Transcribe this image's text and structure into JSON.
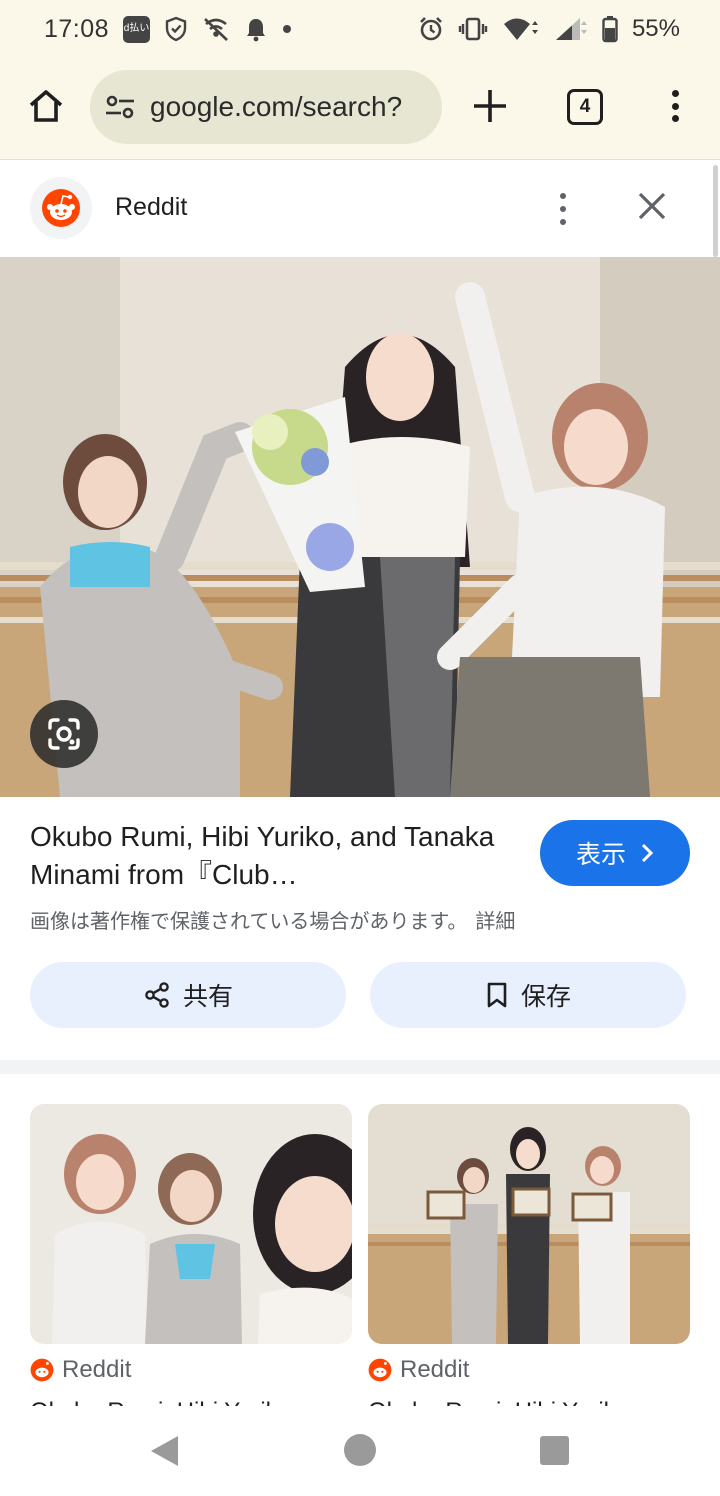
{
  "status_bar": {
    "time": "17:08",
    "dpay_badge": "d払い",
    "battery": "55%",
    "icons": [
      "dpay-icon",
      "shield-icon",
      "wifi-off-call-icon",
      "bell-icon",
      "dot-icon",
      "alarm-icon",
      "vibrate-icon",
      "wifi-icon",
      "signal-icon",
      "battery-icon"
    ]
  },
  "browser": {
    "url": "google.com/search?",
    "tab_count": "4",
    "icons": [
      "home-icon",
      "site-settings-icon",
      "plus-icon",
      "tabs-icon",
      "more-vert-icon"
    ]
  },
  "source": {
    "name": "Reddit",
    "icons": [
      "reddit-icon",
      "more-vert-icon",
      "close-icon"
    ]
  },
  "result": {
    "title": "Okubo Rumi, Hibi Yuriko, and Tanaka Minami from『Club…",
    "view_button": "表示",
    "copyright_note": "画像は著作権で保護されている場合があります。",
    "details_link": "詳細",
    "share_label": "共有",
    "save_label": "保存"
  },
  "related": [
    {
      "source": "Reddit",
      "caption": "Okubo Rumi, Hibi Yuriko…"
    },
    {
      "source": "Reddit",
      "caption": "Okubo Rumi, Hibi Yuriko…"
    }
  ],
  "colors": {
    "accent": "#1a73e8",
    "pill_bg": "#e8f0fe",
    "chrome_bg": "#fbf8ea",
    "reddit_orange": "#ff4500"
  }
}
